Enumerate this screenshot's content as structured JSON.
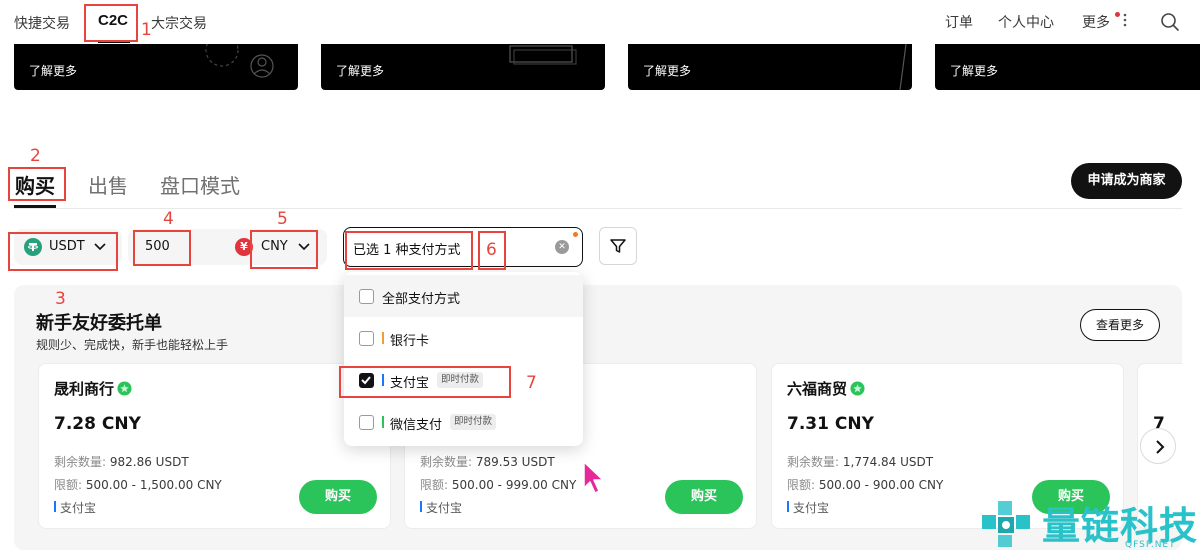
{
  "topnav": {
    "left": [
      "快捷交易",
      "C2C",
      "大宗交易"
    ],
    "right": [
      "订单",
      "个人中心",
      "更多"
    ]
  },
  "banners": [
    "了解更多",
    "了解更多",
    "了解更多",
    "了解更多"
  ],
  "tabs": {
    "buy": "购买",
    "sell": "出售",
    "orderbook": "盘口模式"
  },
  "merchant_button": "申请成为商家",
  "filters": {
    "coin": "USDT",
    "amount": "500",
    "currency_symbol": "¥",
    "currency": "CNY",
    "payment_selected": "已选 1 种支付方式"
  },
  "payment_options": [
    {
      "label": "全部支付方式",
      "checked": false,
      "tag": "",
      "bar_color": ""
    },
    {
      "label": "银行卡",
      "checked": false,
      "tag": "",
      "bar_color": "#f0a030"
    },
    {
      "label": "支付宝",
      "checked": true,
      "tag": "即时付款",
      "bar_color": "#1677ff"
    },
    {
      "label": "微信支付",
      "checked": false,
      "tag": "即时付款",
      "bar_color": "#2bc45a"
    }
  ],
  "promo": {
    "title": "新手友好委托单",
    "subtitle": "规则少、完成快，新手也能轻松上手",
    "view_more": "查看更多",
    "qty_label": "剩余数量:",
    "limit_label": "限额:",
    "buy_label": "购买",
    "cards": [
      {
        "name": "晟利商行",
        "price": "7.28 CNY",
        "qty": "982.86 USDT",
        "limit": "500.00 - 1,500.00 CNY",
        "pay": "支付宝"
      },
      {
        "name": "",
        "price": "",
        "qty": "789.53 USDT",
        "limit": "500.00 - 999.00 CNY",
        "pay": "支付宝"
      },
      {
        "name": "六福商贸",
        "price": "7.31 CNY",
        "qty": "1,774.84 USDT",
        "limit": "500.00 - 900.00 CNY",
        "pay": "支付宝"
      },
      {
        "name": "",
        "price": "7",
        "qty": "",
        "limit": "",
        "pay": ""
      }
    ]
  },
  "annotations": [
    "1",
    "2",
    "3",
    "4",
    "5",
    "6",
    "7"
  ],
  "watermark": {
    "text": "量链科技",
    "sub": "QFSP.NET"
  },
  "colors": {
    "accent_green": "#2bc45a",
    "annotation_red": "#e5453d",
    "primary_dark": "#121212"
  }
}
